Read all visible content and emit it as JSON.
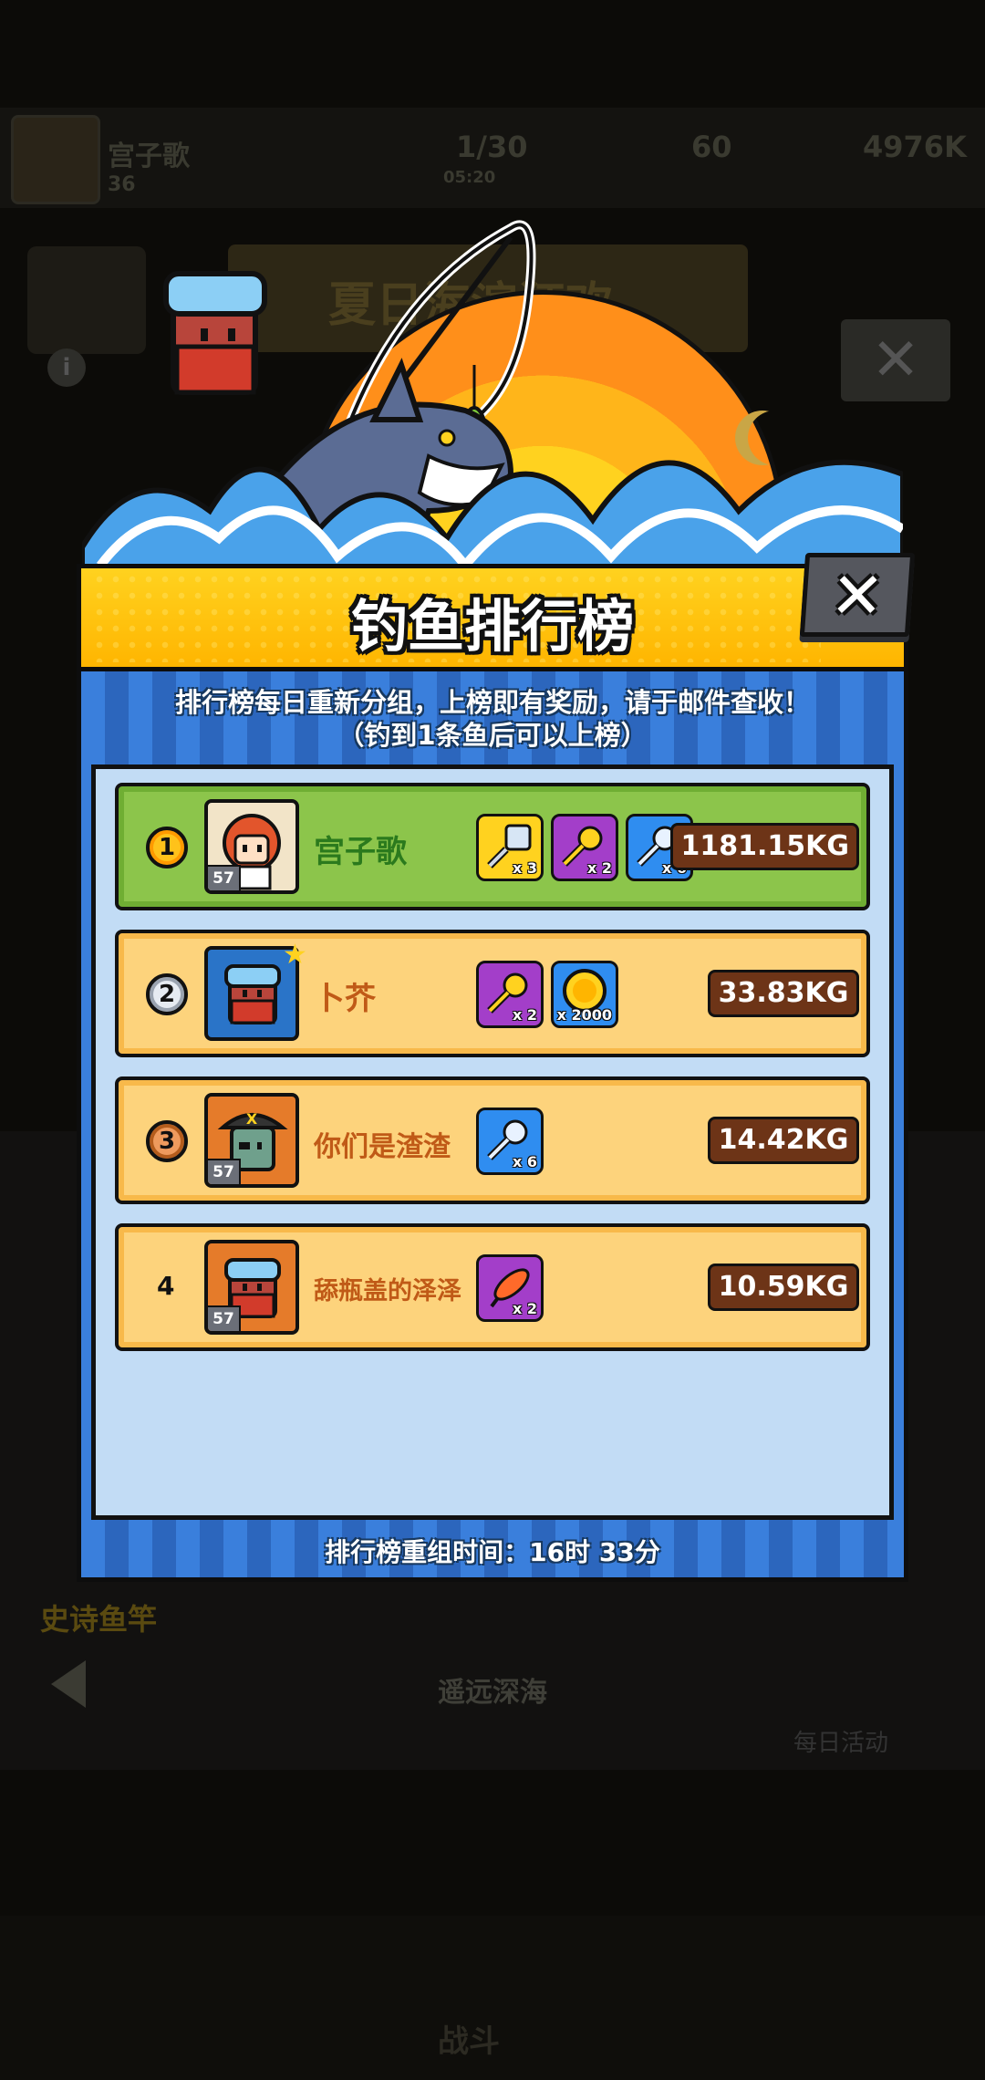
{
  "background": {
    "player_name": "宫子歌",
    "player_level": "36",
    "energy": "1/30",
    "energy_timer": "05:20",
    "gems": "60",
    "coins": "4976K",
    "banner_title": "夏日海滨狂欢",
    "epic_rod_label": "史诗鱼竿",
    "location_label": "遥远深海",
    "daily_activity_label": "每日活动",
    "fight_label": "战斗"
  },
  "popup": {
    "title": "钓鱼排行榜",
    "notice_line1": "排行榜每日重新分组，上榜即有奖励，请于邮件查收！",
    "notice_line2": "（钓到1条鱼后可以上榜）",
    "reset_time": "排行榜重组时间：16时 33分",
    "close_icon": "close-icon",
    "colors": {
      "header": "#ffc21a",
      "panel": "#2f6fc9",
      "first_row": "#8cc54b",
      "other_row": "#fdd37c",
      "weight_badge": "#6d3417"
    }
  },
  "leaderboard": [
    {
      "rank": "1",
      "name": "宫子歌",
      "level": "57",
      "weight": "1181.15KG",
      "rewards": [
        {
          "icon": "silver-key-icon",
          "qty": "x 3"
        },
        {
          "icon": "purple-key-icon",
          "qty": "x 2"
        },
        {
          "icon": "blue-key-icon",
          "qty": "x 6"
        }
      ]
    },
    {
      "rank": "2",
      "name": "卜芥",
      "level": "",
      "weight": "33.83KG",
      "rewards": [
        {
          "icon": "purple-key-icon",
          "qty": "x 2"
        },
        {
          "icon": "gold-coin-icon",
          "qty": "x 2000"
        }
      ]
    },
    {
      "rank": "3",
      "name": "你们是渣渣",
      "level": "57",
      "weight": "14.42KG",
      "rewards": [
        {
          "icon": "blue-key-icon",
          "qty": "x 6"
        }
      ]
    },
    {
      "rank": "4",
      "name": "舔瓶盖的泽泽",
      "level": "57",
      "weight": "10.59KG",
      "rewards": [
        {
          "icon": "fishing-lure-icon",
          "qty": "x 2"
        }
      ]
    }
  ]
}
